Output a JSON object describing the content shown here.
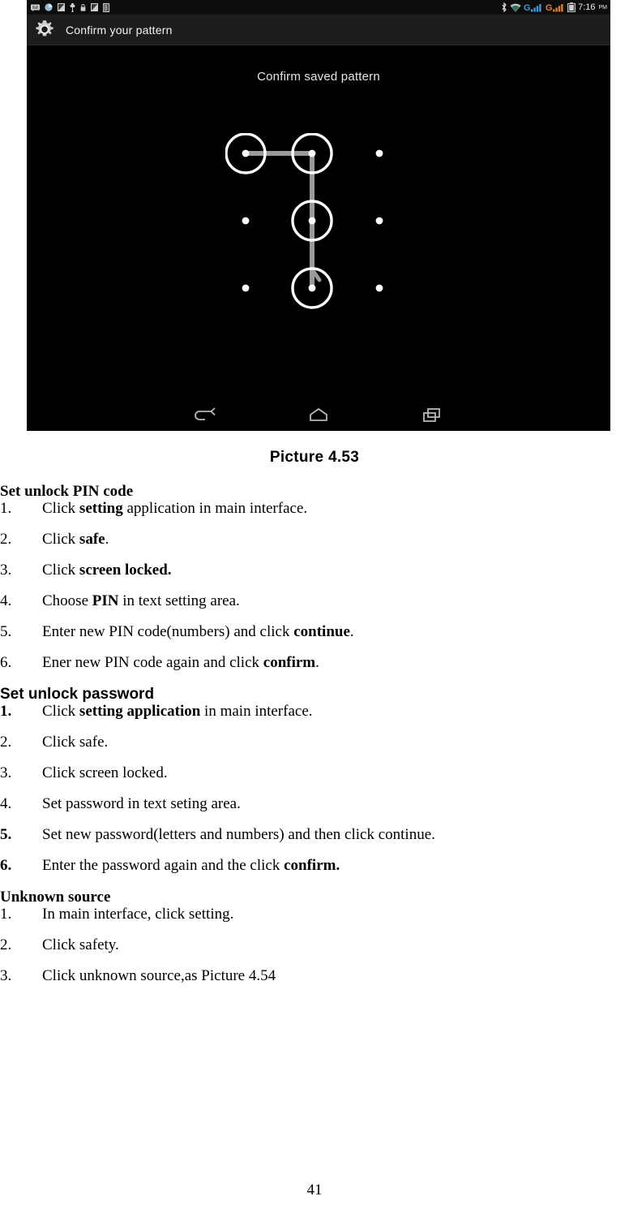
{
  "screenshot": {
    "status_bar": {
      "left_icons": [
        "message-icon",
        "sync-clock-icon",
        "screenshot-icon",
        "usb-icon",
        "lock-icon",
        "screenshot-icon-2",
        "sim-card-icon"
      ],
      "right_icons": [
        "bluetooth-icon",
        "wifi-icon",
        "signal-g-1-icon",
        "signal-g-2-icon",
        "battery-icon"
      ],
      "time": "7:16",
      "time_suffix": "PM",
      "signal_label": "G",
      "colors": {
        "bar_bg": "#0d0d0d",
        "text": "#e8e8e8",
        "signal_1": "#4aa6e0",
        "signal_2": "#e08020"
      }
    },
    "action_bar": {
      "icon": "settings-gear-icon",
      "title": "Confirm your pattern"
    },
    "pattern_screen": {
      "prompt": "Confirm saved pattern",
      "grid": {
        "rows": 3,
        "cols": 3,
        "selected_nodes": [
          0,
          1,
          4,
          7
        ],
        "path": [
          0,
          1,
          4,
          7
        ],
        "node_color": "#ffffff",
        "line_color": "#9a9a9a"
      }
    },
    "nav_bar": {
      "buttons": [
        {
          "name": "back-button",
          "icon": "back-arrow-icon"
        },
        {
          "name": "home-button",
          "icon": "home-icon"
        },
        {
          "name": "recents-button",
          "icon": "recents-icon"
        }
      ]
    }
  },
  "caption": "Picture 4.53",
  "section_pin": {
    "title": "Set unlock PIN code",
    "steps": [
      {
        "num": "1.",
        "pre": "Click ",
        "bold": "setting",
        "post": " application in main interface."
      },
      {
        "num": "2.",
        "pre": "Click ",
        "bold": "safe",
        "post": "."
      },
      {
        "num": "3.",
        "pre": "Click ",
        "bold": "screen locked.",
        "post": ""
      },
      {
        "num": "4.",
        "pre": "Choose ",
        "bold": "PIN",
        "post": " in text setting area."
      },
      {
        "num": "5.",
        "pre": "Enter new PIN code(numbers) and click ",
        "bold": "continue",
        "post": "."
      },
      {
        "num": "6.",
        "pre": "Ener new PIN code again and click ",
        "bold": "confirm",
        "post": "."
      }
    ]
  },
  "section_password": {
    "title": "Set unlock password",
    "steps": [
      {
        "num": "1.",
        "pre": "Click ",
        "bold": "setting application",
        "post": " in main interface."
      },
      {
        "num": "2.",
        "pre": "Click safe.",
        "bold": "",
        "post": ""
      },
      {
        "num": "3.",
        "pre": "Click screen locked.",
        "bold": "",
        "post": ""
      },
      {
        "num": "4.",
        "pre": "Set password in text seting area.",
        "bold": "",
        "post": ""
      },
      {
        "num": "5.",
        "pre": "Set new password(letters and numbers) and then click continue.",
        "bold": "",
        "post": ""
      },
      {
        "num": "6.",
        "pre": "Enter the password again and the click ",
        "bold": "confirm.",
        "post": ""
      }
    ]
  },
  "section_unknown": {
    "title": "Unknown source",
    "steps": [
      {
        "num": "1.",
        "pre": "In main interface, click setting.",
        "bold": "",
        "post": ""
      },
      {
        "num": "2.",
        "pre": "Click safety.",
        "bold": "",
        "post": ""
      },
      {
        "num": "3.",
        "pre": "Click unknown source,as Picture 4.54",
        "bold": "",
        "post": ""
      }
    ]
  },
  "page_number": "41"
}
